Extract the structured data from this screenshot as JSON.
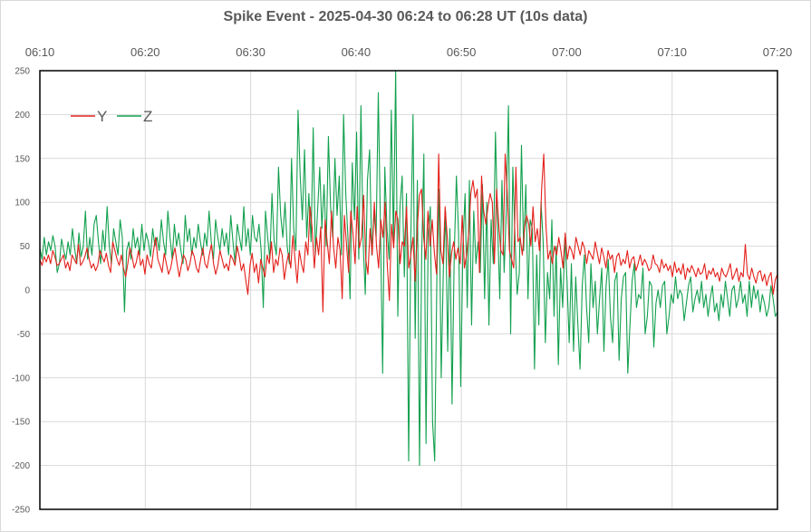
{
  "chart_data": {
    "type": "line",
    "title": "Spike Event - 2025-04-30  06:24 to 06:28 UT (10s data)",
    "xlabel": "",
    "ylabel": "",
    "x_ticks": [
      "06:10",
      "06:20",
      "06:30",
      "06:40",
      "06:50",
      "07:00",
      "07:10",
      "07:20"
    ],
    "x_range": [
      "06:10",
      "07:20"
    ],
    "y_ticks": [
      250,
      200,
      150,
      100,
      50,
      0,
      -50,
      -100,
      -150,
      -200,
      -250
    ],
    "ylim": [
      -250,
      250
    ],
    "grid": true,
    "legend_position": "top-left",
    "sample_interval_s": 10,
    "series": [
      {
        "name": "Y",
        "color": "#e3201b",
        "values": [
          35,
          28,
          38,
          32,
          40,
          30,
          45,
          38,
          28,
          30,
          35,
          40,
          25,
          32,
          22,
          40,
          35,
          30,
          52,
          28,
          32,
          38,
          48,
          35,
          25,
          30,
          22,
          28,
          45,
          38,
          32,
          42,
          28,
          20,
          55,
          45,
          35,
          28,
          40,
          25,
          15,
          30,
          48,
          38,
          25,
          32,
          45,
          28,
          35,
          18,
          40,
          30,
          25,
          45,
          60,
          35,
          28,
          20,
          42,
          30,
          18,
          25,
          38,
          48,
          30,
          15,
          28,
          40,
          35,
          22,
          30,
          45,
          38,
          25,
          20,
          35,
          48,
          30,
          25,
          40,
          52,
          30,
          18,
          28,
          45,
          35,
          25,
          30,
          22,
          40,
          35,
          28,
          50,
          38,
          22,
          30,
          12,
          -5,
          28,
          42,
          20,
          30,
          8,
          35,
          25,
          15,
          40,
          30,
          55,
          20,
          35,
          28,
          48,
          40,
          12,
          30,
          42,
          25,
          62,
          35,
          8,
          45,
          30,
          20,
          55,
          40,
          95,
          70,
          25,
          60,
          40,
          72,
          -25,
          80,
          55,
          30,
          90,
          48,
          25,
          60,
          45,
          -10,
          85,
          52,
          20,
          90,
          65,
          30,
          95,
          48,
          60,
          108,
          35,
          18,
          70,
          40,
          100,
          50,
          25,
          80,
          60,
          100,
          30,
          -12,
          75,
          48,
          90,
          80,
          30,
          55,
          50,
          95,
          25,
          40,
          60,
          10,
          70,
          108,
          115,
          60,
          35,
          90,
          50,
          80,
          42,
          18,
          155,
          45,
          30,
          95,
          60,
          15,
          42,
          55,
          35,
          48,
          30,
          85,
          25,
          40,
          65,
          110,
          125,
          105,
          115,
          20,
          130,
          90,
          75,
          95,
          110,
          100,
          30,
          115,
          75,
          45,
          40,
          155,
          110,
          45,
          35,
          25,
          140,
          55,
          60,
          40,
          70,
          85,
          75,
          50,
          95,
          55,
          70,
          45,
          115,
          155,
          75,
          35,
          45,
          30,
          50,
          40,
          60,
          45,
          25,
          65,
          35,
          50,
          45,
          35,
          60,
          50,
          40,
          55,
          48,
          30,
          45,
          40,
          35,
          55,
          42,
          30,
          48,
          38,
          25,
          45,
          35,
          40,
          20,
          38,
          42,
          28,
          35,
          30,
          45,
          25,
          35,
          38,
          22,
          30,
          40,
          28,
          35,
          30,
          22,
          25,
          40,
          30,
          28,
          20,
          35,
          25,
          30,
          22,
          28,
          15,
          32,
          20,
          25,
          18,
          30,
          12,
          25,
          20,
          28,
          22,
          15,
          25,
          18,
          20,
          30,
          12,
          22,
          18,
          25,
          15,
          20,
          10,
          25,
          18,
          15,
          22,
          30,
          12,
          18,
          25,
          10,
          20,
          15,
          52,
          18,
          12,
          25,
          15,
          8,
          20,
          22,
          10,
          18,
          5,
          15,
          20,
          -5,
          12,
          18
        ]
      },
      {
        "name": "Z",
        "color": "#12a04e",
        "values": [
          48,
          35,
          60,
          40,
          55,
          45,
          62,
          50,
          20,
          30,
          58,
          45,
          35,
          55,
          40,
          70,
          48,
          30,
          65,
          38,
          50,
          90,
          35,
          60,
          40,
          75,
          85,
          55,
          30,
          68,
          45,
          95,
          50,
          30,
          70,
          55,
          40,
          80,
          60,
          -25,
          45,
          55,
          35,
          70,
          48,
          60,
          40,
          75,
          45,
          65,
          55,
          38,
          70,
          50,
          60,
          45,
          80,
          55,
          40,
          90,
          60,
          35,
          75,
          50,
          65,
          45,
          30,
          85,
          55,
          70,
          40,
          60,
          48,
          75,
          55,
          40,
          65,
          50,
          90,
          55,
          35,
          80,
          60,
          45,
          70,
          50,
          65,
          40,
          85,
          55,
          30,
          75,
          60,
          45,
          95,
          50,
          70,
          40,
          85,
          60,
          55,
          75,
          45,
          -20,
          90,
          60,
          35,
          110,
          55,
          40,
          140,
          85,
          60,
          100,
          50,
          30,
          150,
          70,
          45,
          205,
          130,
          80,
          160,
          60,
          110,
          55,
          185,
          40,
          90,
          140,
          70,
          120,
          50,
          175,
          95,
          60,
          150,
          85,
          130,
          40,
          200,
          110,
          60,
          -10,
          145,
          80,
          180,
          35,
          210,
          55,
          -5,
          125,
          160,
          40,
          90,
          60,
          225,
          70,
          -95,
          140,
          70,
          35,
          205,
          55,
          250,
          -30,
          95,
          130,
          15,
          110,
          -195,
          60,
          200,
          -55,
          125,
          -200,
          40,
          155,
          -175,
          65,
          95,
          -150,
          -195,
          15,
          115,
          -100,
          25,
          90,
          -70,
          70,
          -130,
          40,
          130,
          65,
          -110,
          50,
          110,
          -20,
          125,
          -40,
          90,
          30,
          55,
          20,
          120,
          -10,
          100,
          -40,
          80,
          30,
          180,
          75,
          -10,
          125,
          20,
          90,
          210,
          -50,
          140,
          60,
          -5,
          20,
          165,
          45,
          120,
          -10,
          80,
          70,
          -90,
          40,
          -40,
          100,
          55,
          -60,
          20,
          -10,
          80,
          -30,
          50,
          -85,
          25,
          -20,
          60,
          10,
          -60,
          30,
          -70,
          15,
          -40,
          -90,
          5,
          40,
          -20,
          -60,
          30,
          -20,
          10,
          -50,
          -10,
          25,
          -70,
          5,
          35,
          -30,
          -60,
          10,
          20,
          -80,
          -10,
          15,
          20,
          -95,
          -40,
          10,
          30,
          -20,
          -5,
          -10,
          25,
          -50,
          -30,
          10,
          5,
          -65,
          -15,
          0,
          -20,
          5,
          10,
          -50,
          -30,
          -5,
          -15,
          15,
          -10,
          0,
          -5,
          -35,
          -15,
          5,
          15,
          -25,
          -10,
          0,
          -15,
          10,
          -20,
          -5,
          -30,
          -10,
          5,
          -25,
          -15,
          -35,
          -5,
          -20,
          10,
          -10,
          -30,
          0,
          5,
          -20,
          -10,
          10,
          -15,
          -5,
          -30,
          10,
          -20,
          5,
          -10,
          0,
          -25,
          -5,
          -15,
          -30,
          -20,
          5,
          -10,
          -30,
          -25
        ]
      }
    ]
  }
}
